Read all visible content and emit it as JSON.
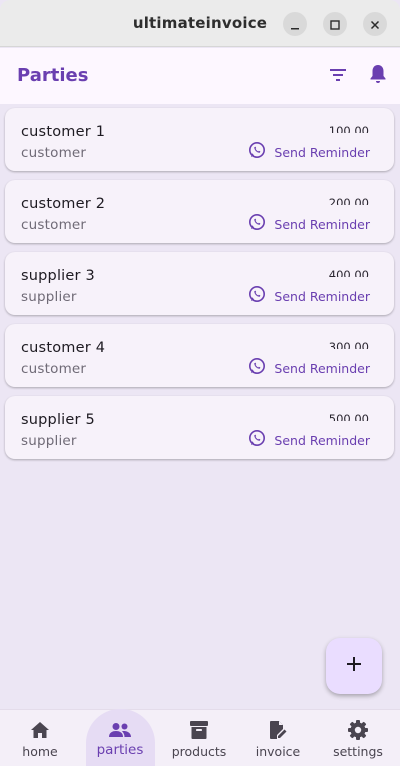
{
  "window": {
    "title": "ultimateinvoice"
  },
  "appbar": {
    "title": "Parties"
  },
  "parties": [
    {
      "name": "customer 1",
      "type": "customer",
      "amount": "100.00",
      "action": "Send Reminder"
    },
    {
      "name": "customer 2",
      "type": "customer",
      "amount": "200.00",
      "action": "Send Reminder"
    },
    {
      "name": "supplier 3",
      "type": "supplier",
      "amount": "400.00",
      "action": "Send Reminder"
    },
    {
      "name": "customer 4",
      "type": "customer",
      "amount": "300.00",
      "action": "Send Reminder"
    },
    {
      "name": "supplier 5",
      "type": "supplier",
      "amount": "500.00",
      "action": "Send Reminder"
    }
  ],
  "nav": [
    {
      "label": "home",
      "icon": "home-icon"
    },
    {
      "label": "parties",
      "icon": "people-icon",
      "active": true
    },
    {
      "label": "products",
      "icon": "archive-icon"
    },
    {
      "label": "invoice",
      "icon": "edit-document-icon"
    },
    {
      "label": "settings",
      "icon": "gear-icon"
    }
  ],
  "colors": {
    "accent": "#6a3fb0",
    "background": "#ece6f4",
    "card": "#f7f2fa",
    "fab": "#eaddff"
  }
}
